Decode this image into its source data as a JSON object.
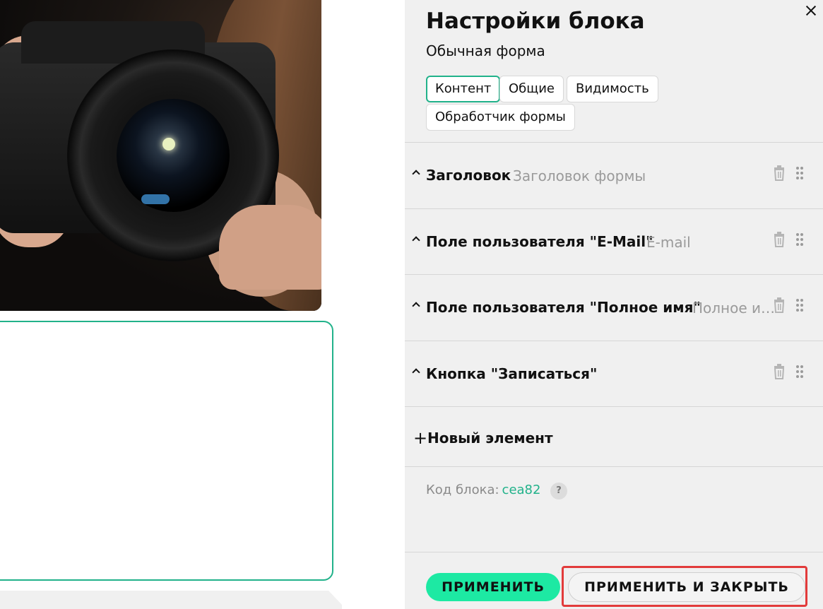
{
  "panel": {
    "title": "Настройки блока",
    "subtitle": "Обычная форма",
    "tabs": [
      {
        "label": "Контент",
        "active": true
      },
      {
        "label": "Общие",
        "active": false
      },
      {
        "label": "Видимость",
        "active": false
      },
      {
        "label": "Обработчик формы",
        "active": false
      }
    ],
    "items": [
      {
        "title": "Заголовок",
        "hint": "Заголовок формы"
      },
      {
        "title": "Поле пользователя \"E-Mail\"",
        "hint": "E-mail"
      },
      {
        "title": "Поле пользователя \"Полное имя\"",
        "hint": "Полное имя"
      },
      {
        "title": "Кнопка \"Записаться\"",
        "hint": ""
      }
    ],
    "new_element_label": "Новый элемент",
    "block_code_label": "Код блока:",
    "block_code_value": "cea82",
    "help_glyph": "?",
    "apply_label": "ПРИМЕНИТЬ",
    "apply_close_label": "ПРИМЕНИТЬ И ЗАКРЫТЬ"
  },
  "colors": {
    "accent": "#21b28a",
    "apply_button": "#1de9a3",
    "highlight": "#e23b3b",
    "panel_bg": "#f0f0f0"
  },
  "icons": {
    "close": "close-icon",
    "caret": "chevron-up-icon",
    "trash": "trash-icon",
    "drag": "drag-handle-icon",
    "plus": "plus-icon",
    "help": "help-icon"
  }
}
